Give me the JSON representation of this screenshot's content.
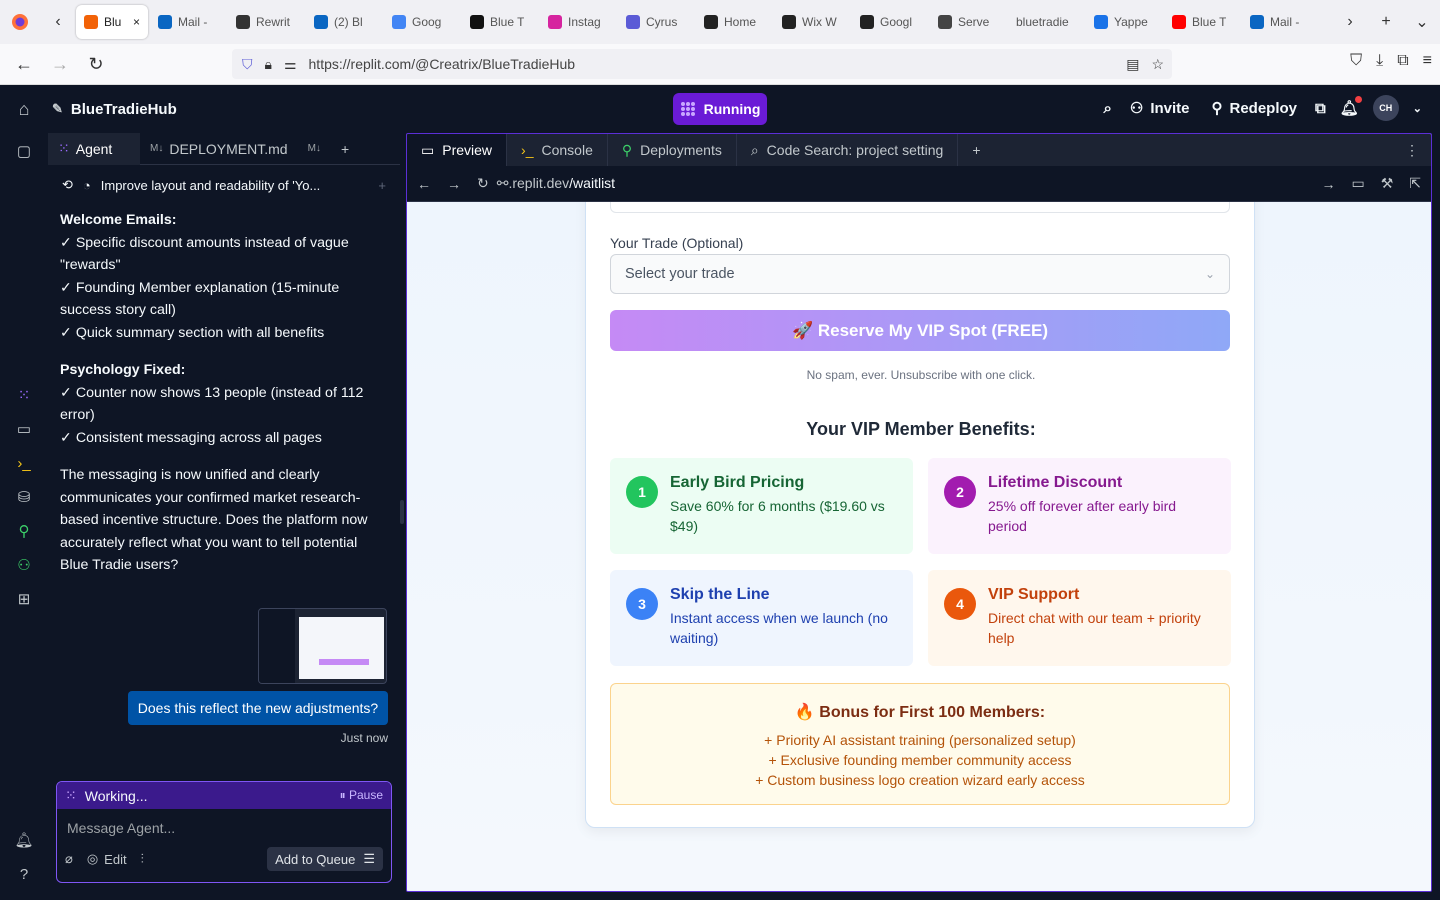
{
  "browser": {
    "tabs": [
      {
        "label": "Blu",
        "fav": "#f26207",
        "active": true
      },
      {
        "label": "Mail -",
        "fav": "#0a66c2"
      },
      {
        "label": "Rewrit",
        "fav": "#333"
      },
      {
        "label": "(2) Bl",
        "fav": "#0a66c2"
      },
      {
        "label": "Goog",
        "fav": "#4285f4"
      },
      {
        "label": "Blue T",
        "fav": "#111"
      },
      {
        "label": "Instag",
        "fav": "#d6249f"
      },
      {
        "label": "Cyrus",
        "fav": "#5b5bd6"
      },
      {
        "label": "Home",
        "fav": "#222"
      },
      {
        "label": "Wix W",
        "fav": "#222"
      },
      {
        "label": "Googl",
        "fav": "#222"
      },
      {
        "label": "Serve",
        "fav": "#444"
      },
      {
        "label": "bluetradie",
        "fav": ""
      },
      {
        "label": "Yappe",
        "fav": "#1a73e8"
      },
      {
        "label": "Blue T",
        "fav": "#ff0000"
      },
      {
        "label": "Mail -",
        "fav": "#0a66c2"
      }
    ],
    "url": "https://replit.com/@Creatrix/BlueTradieHub"
  },
  "replit": {
    "project_name": "BlueTradieHub",
    "run_label": "Running",
    "invite_label": "Invite",
    "redeploy_label": "Redeploy",
    "avatar_initials": "CH"
  },
  "agent": {
    "tabs": [
      {
        "label": "Agent"
      },
      {
        "label": "DEPLOYMENT.md"
      }
    ],
    "chat_title": "Improve layout and readability of 'Yo...",
    "messages": [
      {
        "heading": "Welcome Emails:",
        "lines": [
          "✓ Specific discount amounts instead of vague \"rewards\"",
          "✓ Founding Member explanation (15-minute success story call)",
          "✓ Quick summary section with all benefits"
        ]
      },
      {
        "heading": "Psychology Fixed:",
        "lines": [
          "✓ Counter now shows 13 people (instead of 112 error)",
          "✓ Consistent messaging across all pages"
        ]
      },
      {
        "heading": "",
        "lines": [
          "The messaging is now unified and clearly communicates your confirmed market research-based incentive structure. Does the platform now accurately reflect what you want to tell potential Blue Tradie users?"
        ]
      }
    ],
    "user_message": "Does this reflect the new adjustments?",
    "timestamp": "Just now",
    "working_label": "Working...",
    "pause_label": "Pause",
    "input_placeholder": "Message Agent...",
    "edit_label": "Edit",
    "add_queue_label": "Add to Queue"
  },
  "preview": {
    "tabs": [
      {
        "label": "Preview"
      },
      {
        "label": "Console"
      },
      {
        "label": "Deployments"
      },
      {
        "label": "Code Search: project setting"
      }
    ],
    "url_host": ".replit.dev",
    "url_path": "/waitlist",
    "form": {
      "trade_label": "Your Trade (Optional)",
      "trade_placeholder": "Select your trade",
      "cta_label": "🚀 Reserve My VIP Spot (FREE)",
      "no_spam": "No spam, ever. Unsubscribe with one click."
    },
    "benefits_heading": "Your VIP Member Benefits:",
    "benefits": [
      {
        "num": "1",
        "title": "Early Bird Pricing",
        "desc": "Save 60% for 6 months ($19.60 vs $49)",
        "color": "#22c55e",
        "bg": "#ecfdf3",
        "text": "#166534"
      },
      {
        "num": "2",
        "title": "Lifetime Discount",
        "desc": "25% off forever after early bird period",
        "color": "#a21caf",
        "bg": "#fbf2fd",
        "text": "#86198f"
      },
      {
        "num": "3",
        "title": "Skip the Line",
        "desc": "Instant access when we launch (no waiting)",
        "color": "#3b82f6",
        "bg": "#eff5fe",
        "text": "#1e40af"
      },
      {
        "num": "4",
        "title": "VIP Support",
        "desc": "Direct chat with our team + priority help",
        "color": "#ea580c",
        "bg": "#fff7ed",
        "text": "#c2410c"
      }
    ],
    "bonus": {
      "heading": "🔥 Bonus for First 100 Members:",
      "lines": [
        "+ Priority AI assistant training (personalized setup)",
        "+ Exclusive founding member community access",
        "+ Custom business logo creation wizard early access"
      ]
    }
  }
}
